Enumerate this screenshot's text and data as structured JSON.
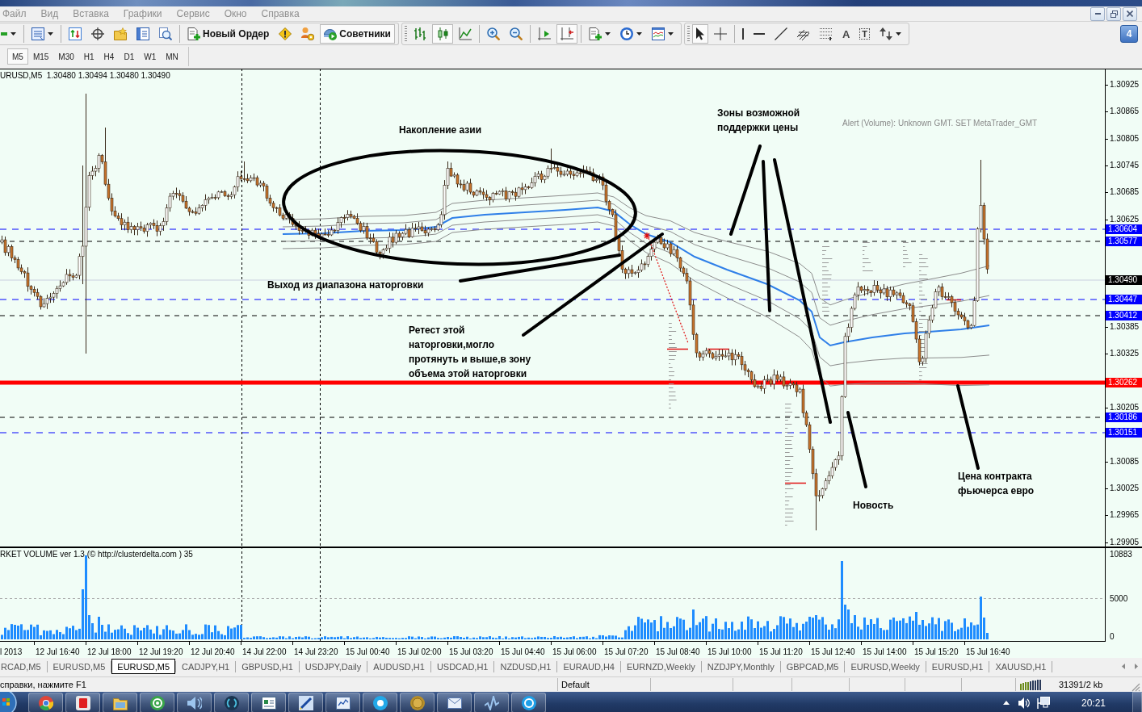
{
  "menu": [
    "Файл",
    "Вид",
    "Вставка",
    "Графики",
    "Сервис",
    "Окно",
    "Справка"
  ],
  "toolbars": [
    {
      "groups": [
        [
          {
            "kind": "new-chart",
            "dropdown": true,
            "pressed": false
          }
        ],
        [
          {
            "kind": "profiles",
            "dropdown": true,
            "pressed": false
          }
        ],
        [
          {
            "kind": "market-watch",
            "dropdown": false,
            "pressed": false
          },
          {
            "kind": "data-window",
            "dropdown": false,
            "pressed": false
          },
          {
            "kind": "navigator",
            "dropdown": false,
            "pressed": false
          },
          {
            "kind": "terminal",
            "dropdown": false,
            "pressed": false
          },
          {
            "kind": "tester",
            "dropdown": false,
            "pressed": false
          }
        ],
        [
          {
            "kind": "new-order",
            "label": "Новый Ордер",
            "dropdown": false,
            "pressed": false
          },
          {
            "kind": "alert",
            "dropdown": false,
            "pressed": false
          },
          {
            "kind": "people",
            "dropdown": false,
            "pressed": false
          },
          {
            "kind": "experts",
            "label": "Советники",
            "dropdown": false,
            "pressed": true
          }
        ]
      ]
    },
    {
      "groups": [
        [
          {
            "kind": "bar-chart",
            "dropdown": false,
            "pressed": false
          },
          {
            "kind": "candles",
            "dropdown": false,
            "pressed": true
          },
          {
            "kind": "line-chart",
            "dropdown": false,
            "pressed": false
          }
        ],
        [
          {
            "kind": "zoom-in",
            "dropdown": false,
            "pressed": false
          },
          {
            "kind": "zoom-out",
            "dropdown": false,
            "pressed": false
          }
        ],
        [
          {
            "kind": "chart-shift",
            "dropdown": false,
            "pressed": false
          },
          {
            "kind": "autoscroll",
            "dropdown": false,
            "pressed": true
          }
        ],
        [
          {
            "kind": "indicators",
            "dropdown": true,
            "pressed": false
          },
          {
            "kind": "periods",
            "dropdown": true,
            "pressed": false
          },
          {
            "kind": "templates",
            "dropdown": true,
            "pressed": false
          }
        ]
      ]
    },
    {
      "groups": [
        [
          {
            "kind": "cursor",
            "dropdown": false,
            "pressed": true
          },
          {
            "kind": "crosshair",
            "dropdown": false,
            "pressed": false
          }
        ],
        [
          {
            "kind": "vline",
            "dropdown": false,
            "pressed": false
          },
          {
            "kind": "hline",
            "dropdown": false,
            "pressed": false
          },
          {
            "kind": "trendline",
            "dropdown": false,
            "pressed": false
          },
          {
            "kind": "fibo-e",
            "dropdown": false,
            "pressed": false
          },
          {
            "kind": "fibo-f",
            "dropdown": false,
            "pressed": false
          },
          {
            "kind": "text-tool",
            "label": "A",
            "dropdown": false,
            "pressed": false
          },
          {
            "kind": "label-tool",
            "label": "T",
            "dropdown": false,
            "pressed": false
          },
          {
            "kind": "arrows",
            "dropdown": true,
            "pressed": false
          }
        ]
      ]
    }
  ],
  "messages_count": "4",
  "timeframes": [
    {
      "label": "M5",
      "selected": true
    },
    {
      "label": "M15",
      "selected": false
    },
    {
      "label": "M30",
      "selected": false
    },
    {
      "label": "H1",
      "selected": false
    },
    {
      "label": "H4",
      "selected": false
    },
    {
      "label": "D1",
      "selected": false
    },
    {
      "label": "W1",
      "selected": false
    },
    {
      "label": "MN",
      "selected": false
    }
  ],
  "chart": {
    "header": "URUSD,M5  1.30480 1.30494 1.30480 1.30490",
    "alert": "Alert (Volume): Unknown GMT. SET MetaTrader_GMT",
    "price_axis": [
      "1.30925",
      "1.30865",
      "1.30805",
      "1.30745",
      "1.30685",
      "1.30625",
      "1.30385",
      "1.30325",
      "1.30205",
      "1.30085",
      "1.30025",
      "1.29965",
      "1.29905"
    ],
    "levels": [
      {
        "label": "1.30604",
        "kind": "dashed",
        "color": "#0000ff"
      },
      {
        "label": "1.30577",
        "kind": "dark-dashed",
        "color": "#0000ff"
      },
      {
        "label": "1.30490",
        "kind": "bid",
        "color": "#000000"
      },
      {
        "label": "1.30447",
        "kind": "dashed",
        "color": "#0000ff"
      },
      {
        "label": "1.30412",
        "kind": "dark-dashed",
        "color": "#0000ff"
      },
      {
        "label": "1.30262",
        "kind": "thick",
        "color": "#ff0000"
      },
      {
        "label": "1.30186",
        "kind": "dark-dashed",
        "color": "#0000ff"
      },
      {
        "label": "1.30151",
        "kind": "dashed",
        "color": "#0000ff"
      }
    ],
    "annotations": [
      "Накопление азии",
      "Выход из диапазона наторговки",
      "Ретест этой наторговки,могло протянуть и выше,в зону объема этой наторговки",
      "Зоны возможной поддержки цены",
      "Новость",
      "Цена контракта фьючерса евро"
    ]
  },
  "volume": {
    "header": "RKET VOLUME ver 1.3 (© http://clusterdelta.com ) 35",
    "axis": [
      "10883",
      "5000",
      "0"
    ]
  },
  "time_axis": [
    "l 2013",
    "12 Jul 16:40",
    "12 Jul 18:00",
    "12 Jul 19:20",
    "12 Jul 20:40",
    "14 Jul 22:00",
    "14 Jul 23:20",
    "15 Jul 00:40",
    "15 Jul 02:00",
    "15 Jul 03:20",
    "15 Jul 04:40",
    "15 Jul 06:00",
    "15 Jul 07:20",
    "15 Jul 08:40",
    "15 Jul 10:00",
    "15 Jul 11:20",
    "15 Jul 12:40",
    "15 Jul 14:00",
    "15 Jul 15:20",
    "15 Jul 16:40"
  ],
  "tabs": [
    {
      "label": "RCAD,M5",
      "selected": false
    },
    {
      "label": "EURUSD,M5",
      "selected": false
    },
    {
      "label": "EURUSD,M5",
      "selected": true
    },
    {
      "label": "CADJPY,H1",
      "selected": false
    },
    {
      "label": "GBPUSD,H1",
      "selected": false
    },
    {
      "label": "USDJPY,Daily",
      "selected": false
    },
    {
      "label": "AUDUSD,H1",
      "selected": false
    },
    {
      "label": "USDCAD,H1",
      "selected": false
    },
    {
      "label": "NZDUSD,H1",
      "selected": false
    },
    {
      "label": "EURAUD,H4",
      "selected": false
    },
    {
      "label": "EURNZD,Weekly",
      "selected": false
    },
    {
      "label": "NZDJPY,Monthly",
      "selected": false
    },
    {
      "label": "GBPCAD,M5",
      "selected": false
    },
    {
      "label": "EURUSD,Weekly",
      "selected": false
    },
    {
      "label": "EURUSD,H1",
      "selected": false
    },
    {
      "label": "XAUUSD,H1",
      "selected": false
    }
  ],
  "status_bar": {
    "help": "справки, нажмите F1",
    "profile": "Default",
    "traffic": "31391/2 kb"
  },
  "taskbar": {
    "clock": "20:21"
  }
}
